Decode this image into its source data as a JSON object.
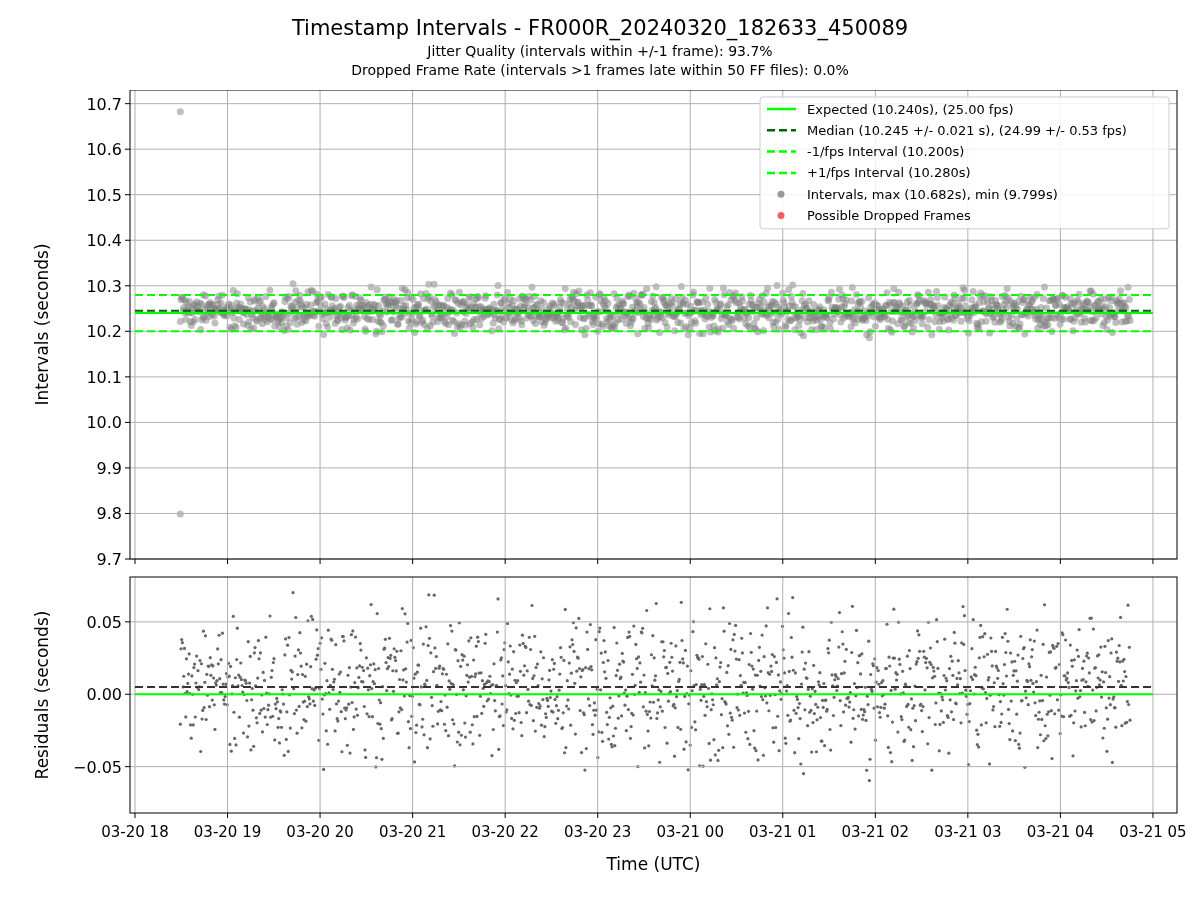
{
  "figure": {
    "title": "Timestamp Intervals - FR000R_20240320_182633_450089",
    "subtitles": [
      "Jitter Quality (intervals within +/-1 frame): 93.7%",
      "Dropped Frame Rate (intervals >1 frames late within 50 FF files): 0.0%"
    ]
  },
  "charts": [
    {
      "legend_markers": [
        {
          "label": "Intervals, max (10.682s), min (9.799s)",
          "color": "#999999"
        },
        {
          "label": "Possible Dropped Frames",
          "color": "#f06060"
        }
      ],
      "chart_data": {
        "type": "line",
        "ylabel": "Intervals (seconds)",
        "grid": true,
        "legend": "upper right",
        "categories": [
          null,
          null,
          null,
          null,
          null,
          null,
          null,
          null,
          null,
          null,
          null,
          null
        ],
        "ylim": [
          9.7,
          10.73
        ],
        "yticks": [
          {
            "value": 9.7,
            "label": "9.7"
          },
          {
            "value": 9.8,
            "label": "9.8"
          },
          {
            "value": 9.9,
            "label": "9.9"
          },
          {
            "value": 10.0,
            "label": "10.0"
          },
          {
            "value": 10.1,
            "label": "10.1"
          },
          {
            "value": 10.2,
            "label": "10.2"
          },
          {
            "value": 10.3,
            "label": "10.3"
          },
          {
            "value": 10.4,
            "label": "10.4"
          },
          {
            "value": 10.5,
            "label": "10.5"
          },
          {
            "value": 10.6,
            "label": "10.6"
          },
          {
            "value": 10.7,
            "label": "10.7"
          }
        ],
        "series": [
          {
            "name": "Expected (10.240s), (25.00 fps)",
            "color": "#00ff00",
            "line_style": "solid",
            "values": [
              10.24,
              10.24,
              10.24,
              10.24,
              10.24,
              10.24,
              10.24,
              10.24,
              10.24,
              10.24,
              10.24,
              10.24
            ]
          },
          {
            "name": "Median (10.245 +/- 0.021 s), (24.99 +/- 0.53 fps)",
            "color": "#006400",
            "line_style": "dashed",
            "values": [
              10.245,
              10.245,
              10.245,
              10.245,
              10.245,
              10.245,
              10.245,
              10.245,
              10.245,
              10.245,
              10.245,
              10.245
            ]
          },
          {
            "name": "-1/fps Interval (10.200s)",
            "color": "#00ff00",
            "line_style": "dashed",
            "values": [
              10.2,
              10.2,
              10.2,
              10.2,
              10.2,
              10.2,
              10.2,
              10.2,
              10.2,
              10.2,
              10.2,
              10.2
            ]
          },
          {
            "name": "+1/fps Interval (10.280s)",
            "color": "#00ff00",
            "line_style": "dashed",
            "values": [
              10.28,
              10.28,
              10.28,
              10.28,
              10.28,
              10.28,
              10.28,
              10.28,
              10.28,
              10.28,
              10.28,
              10.28
            ]
          }
        ]
      }
    },
    {
      "chart_data": {
        "type": "line",
        "ylabel": "Residuals (seconds)",
        "xlabel": "Time (UTC)",
        "grid": true,
        "categories": [
          "03-20 18",
          "03-20 19",
          "03-20 20",
          "03-20 21",
          "03-20 22",
          "03-20 23",
          "03-21 00",
          "03-21 01",
          "03-21 02",
          "03-21 03",
          "03-21 04",
          "03-21 05"
        ],
        "ylim": [
          -0.082,
          0.081
        ],
        "yticks": [
          {
            "value": -0.05,
            "label": "−0.05"
          },
          {
            "value": 0,
            "label": "0.00"
          },
          {
            "value": 0.05,
            "label": "0.05"
          }
        ],
        "series": [
          {
            "color": "#333333",
            "line_style": "dashed",
            "values": [
              0.005,
              0.005,
              0.005,
              0.005,
              0.005,
              0.005,
              0.005,
              0.005,
              0.005,
              0.005,
              0.005,
              0.005
            ]
          },
          {
            "color": "#00ff00",
            "line_style": "solid",
            "values": [
              0,
              0,
              0,
              0,
              0,
              0,
              0,
              0,
              0,
              0,
              0,
              0
            ]
          }
        ]
      }
    }
  ]
}
